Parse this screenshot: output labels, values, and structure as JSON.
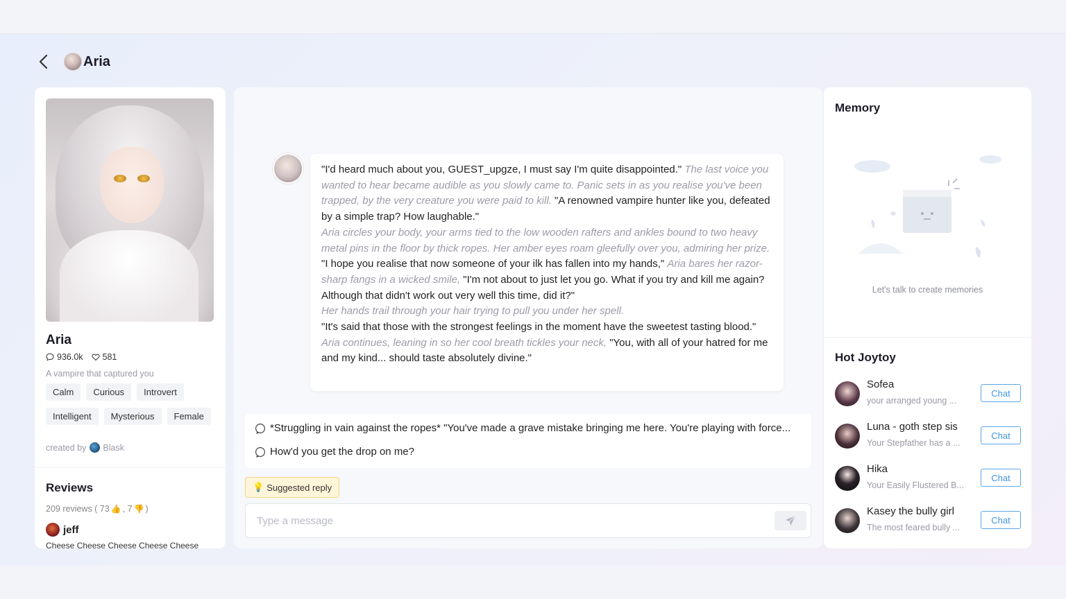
{
  "header": {
    "title": "Aria",
    "back_icon": "back-arrow-icon"
  },
  "profile": {
    "name": "Aria",
    "views": "936.0k",
    "likes": "581",
    "tagline": "A vampire that captured you",
    "tags": [
      "Calm",
      "Curious",
      "Introvert",
      "Intelligent",
      "Mysterious",
      "Female"
    ],
    "created_by_label": "created by",
    "creator": "Blask"
  },
  "reviews": {
    "title": "Reviews",
    "count_text": "209 reviews ( 73",
    "separator": ", 7",
    "close": ")",
    "up_count": 73,
    "down_count": 7,
    "items": [
      {
        "user": "jeff",
        "text": "Cheese Cheese Cheese Cheese Cheese"
      }
    ]
  },
  "chat": {
    "message_segments": [
      {
        "type": "speech",
        "text": "\"I'd heard much about you, GUEST_upgze, I must say I'm quite disappointed.\""
      },
      {
        "type": "narration",
        "text": "The last voice you wanted to hear became audible as you slowly came to. Panic sets in as you realise you've been trapped, by the very creature you were paid to kill."
      },
      {
        "type": "speech",
        "text": "\"A renowned vampire hunter like you, defeated by a simple trap? How laughable.\""
      },
      {
        "type": "break"
      },
      {
        "type": "narration",
        "text": "Aria circles your body, your arms tied to the low wooden rafters and ankles bound to two heavy metal pins in the floor by thick ropes. Her amber eyes roam gleefully over you, admiring her prize."
      },
      {
        "type": "break"
      },
      {
        "type": "speech",
        "text": "\"I hope you realise that now someone of your ilk has fallen into my hands,\""
      },
      {
        "type": "narration",
        "text": "Aria bares her razor-sharp fangs in a wicked smile,"
      },
      {
        "type": "speech",
        "text": "\"I'm not about to just let you go. What if you try and kill me again? Although that didn't work out very well this time, did it?\""
      },
      {
        "type": "break"
      },
      {
        "type": "narration",
        "text": "Her hands trail through your hair trying to pull you under her spell."
      },
      {
        "type": "break"
      },
      {
        "type": "speech",
        "text": "\"It's said that those with the strongest feelings in the moment have the sweetest tasting blood.\""
      },
      {
        "type": "break"
      },
      {
        "type": "narration",
        "text": "Aria continues, leaning in so her cool breath tickles your neck,"
      },
      {
        "type": "speech",
        "text": "\"You, with all of your hatred for me and my kind... should taste absolutely divine.\""
      }
    ],
    "suggestions": [
      "*Struggling in vain against the ropes* \"You've made a grave mistake bringing me here. You're playing with force...",
      "How'd you get the drop on me?"
    ],
    "suggested_reply_label": "Suggested reply",
    "input_placeholder": "Type a message",
    "input_value": ""
  },
  "memory": {
    "title": "Memory",
    "empty_text": "Let's talk to create memories"
  },
  "hot": {
    "title": "Hot Joytoy",
    "button_label": "Chat",
    "items": [
      {
        "name": "Sofea",
        "desc": "your arranged young ..."
      },
      {
        "name": "Luna - goth step sis",
        "desc": "Your Stepfather has a ..."
      },
      {
        "name": "Hika",
        "desc": "Your Easily Flustered B..."
      },
      {
        "name": "Kasey the bully girl",
        "desc": "The most feared bully ..."
      }
    ]
  },
  "colors": {
    "accent_blue": "#3d95e0",
    "suggest_bg": "#fff6d9",
    "narration_gray": "#9c9ca6"
  }
}
